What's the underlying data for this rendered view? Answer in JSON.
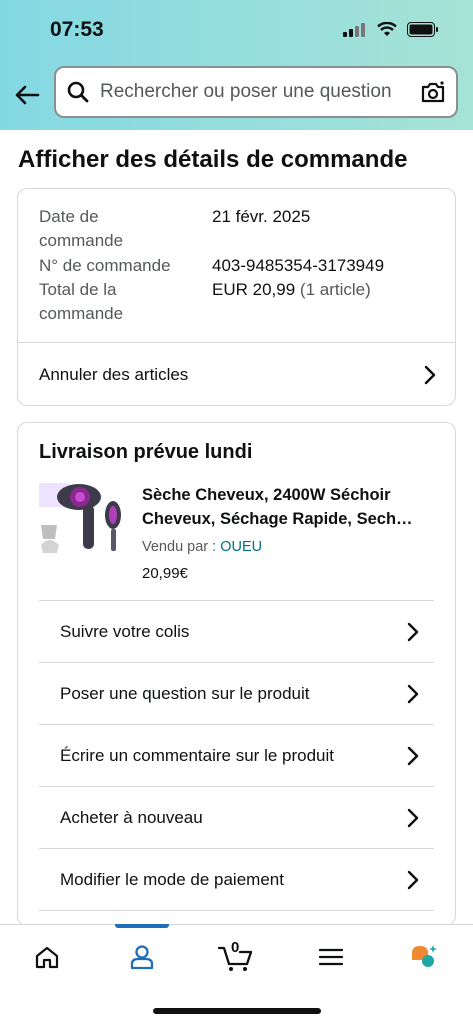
{
  "status_bar": {
    "time": "07:53"
  },
  "search": {
    "placeholder": "Rechercher ou poser une question"
  },
  "page": {
    "title": "Afficher des détails de commande"
  },
  "order_info": {
    "date_label_1": "Date de",
    "date_label_2": "commande",
    "date_value": "21 févr. 2025",
    "number_label": "N° de commande",
    "number_value": "403-9485354-3173949",
    "total_label_1": "Total de la",
    "total_label_2": "commande",
    "total_value": "EUR 20,99",
    "total_count": "(1 article)",
    "cancel_label": "Annuler des articles"
  },
  "delivery": {
    "title": "Livraison prévue lundi",
    "product_line1": "Sèche Cheveux, 2400W Séchoir",
    "product_line2": "Cheveux, Séchage Rapide, Sech…",
    "sold_by_label": "Vendu par",
    "seller": ": OUEU",
    "price": "20,99€",
    "actions": [
      "Suivre votre colis",
      "Poser une question sur le produit",
      "Écrire un commentaire sur le produit",
      "Acheter à nouveau",
      "Modifier le mode de paiement"
    ]
  },
  "tabbar": {
    "cart_count": "0",
    "active_tab": "account"
  },
  "colors": {
    "header_start": "#84d8e4",
    "header_end": "#a6e3d6",
    "link": "#007185",
    "active_tab": "#1f6fb8",
    "assistant_orange": "#f08a32",
    "assistant_teal": "#1ea7a5"
  },
  "icons": [
    "back-arrow-icon",
    "search-icon",
    "camera-icon",
    "chevron-right-icon",
    "home-icon",
    "account-icon",
    "cart-icon",
    "menu-icon",
    "assistant-icon"
  ]
}
